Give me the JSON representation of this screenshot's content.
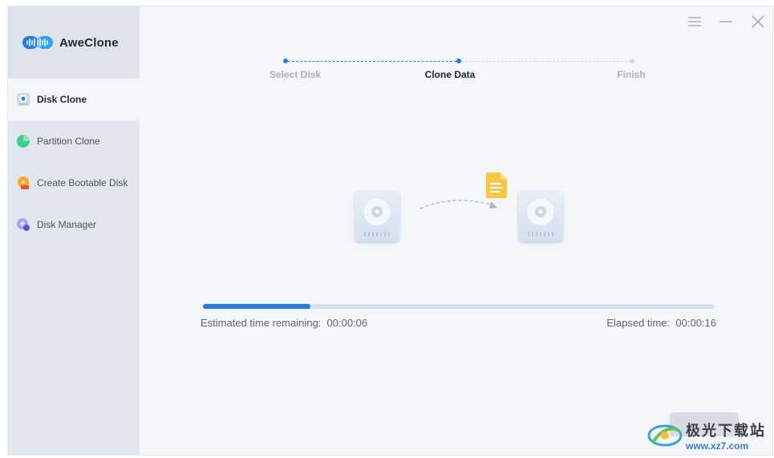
{
  "app": {
    "name": "AweClone"
  },
  "window_controls": {
    "menu_icon": "menu-icon",
    "minimize_icon": "minimize-icon",
    "close_icon": "close-icon"
  },
  "sidebar": {
    "items": [
      {
        "label": "Disk Clone",
        "icon": "disk-clone-icon",
        "active": true
      },
      {
        "label": "Partition Clone",
        "icon": "partition-clone-icon",
        "active": false
      },
      {
        "label": "Create Bootable Disk",
        "icon": "bootable-disk-icon",
        "active": false
      },
      {
        "label": "Disk Manager",
        "icon": "disk-manager-icon",
        "active": false
      }
    ]
  },
  "steps": [
    {
      "label": "Select Disk",
      "state": "done"
    },
    {
      "label": "Clone Data",
      "state": "current"
    },
    {
      "label": "Finish",
      "state": "pending"
    }
  ],
  "progress": {
    "fraction": 0.21,
    "remaining_label": "Estimated time remaining:",
    "remaining_value": "00:00:06",
    "elapsed_label": "Elapsed time:",
    "elapsed_value": "00:00:16"
  },
  "watermark": {
    "title": "极光下载站",
    "url": "www.xz7.com"
  },
  "colors": {
    "accent": "#1f7ce8",
    "track": "#d6e1f3",
    "sidebar": "#e2e7ef",
    "background": "#f4f6fa"
  }
}
